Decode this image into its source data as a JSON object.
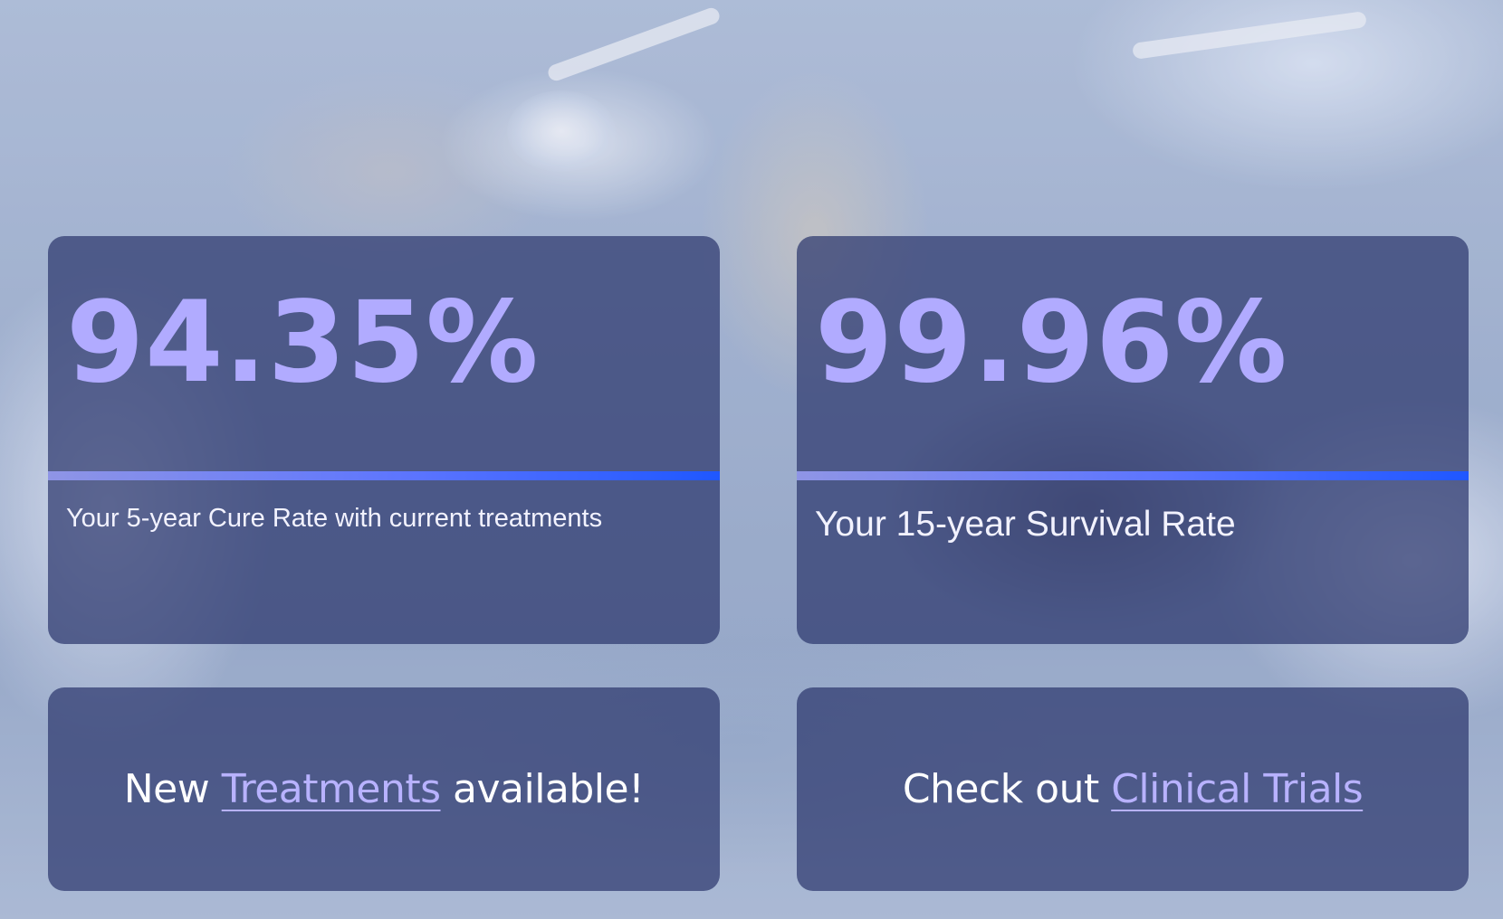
{
  "stats": [
    {
      "value": "94.35%",
      "caption": "Your 5-year Cure Rate with current treatments"
    },
    {
      "value": "99.96%",
      "caption": "Your 15-year Survival Rate"
    }
  ],
  "links": {
    "treatments": {
      "prefix": "New ",
      "link_label": "Treatments",
      "suffix": " available!"
    },
    "clinical_trials": {
      "prefix": "Check out ",
      "link_label": "Clinical Trials"
    }
  },
  "colors": {
    "card_background": "#2d376e",
    "stat_value": "#b1abff",
    "bar_gradient_start": "#8f95e6",
    "bar_gradient_end": "#1f57ff",
    "link": "#b8b2ff",
    "text": "#ffffff"
  }
}
